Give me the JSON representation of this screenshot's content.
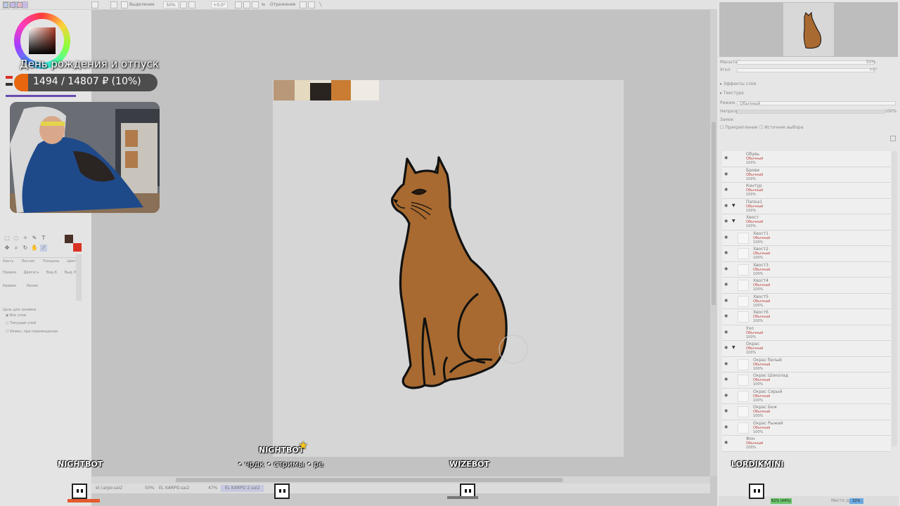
{
  "topbar": {
    "zoom_label": "Выделение",
    "zoom_value": "50%",
    "angle_value": "+0.0°",
    "mirror_label": "Отражение"
  },
  "overlay": {
    "goal_title": "День рождения и отпуск",
    "goal_progress_text": "1494 / 14807 ₽ (10%)",
    "goal_fraction": 0.1,
    "goal_color": "#e8660e"
  },
  "left_panel": {
    "brush_labels": [
      "Кисть",
      "Ластик",
      "Толщина",
      "Цвет"
    ],
    "brush_labels2": [
      "Правка",
      "Двигать",
      "Вид.К",
      "Выд.Л"
    ],
    "brush_labels3": [
      "Кривая",
      "Линия"
    ],
    "fill_section": "Цель для заливки",
    "fill_opt1": "Все слои",
    "fill_opt2": "Текущий слой",
    "fill_opt3": "Измен. при перемещении"
  },
  "right_panel": {
    "zoom_label": "Масштаб",
    "zoom_value": "50%",
    "angle_label": "Угол",
    "angle_value": "+0°",
    "effects_label": "Эффекты слоя",
    "texture_label": "Текстура",
    "mode_label": "Режим",
    "mode_value": "Обычный",
    "opacity_label": "Непрозр.",
    "opacity_value": "100%",
    "lock_label": "Замок",
    "clip_label": "Прикрепление",
    "source_label": "Источник выбора",
    "layers": [
      {
        "name": "Обувь",
        "mode": "Обычный",
        "pct": "100%",
        "indent": 0,
        "folder": false
      },
      {
        "name": "Брови",
        "mode": "Обычный",
        "pct": "100%",
        "indent": 0,
        "folder": false
      },
      {
        "name": "Контур",
        "mode": "Обычный",
        "pct": "100%",
        "indent": 0,
        "folder": false
      },
      {
        "name": "Папка1",
        "mode": "Обычный",
        "pct": "100%",
        "indent": 0,
        "folder": true
      },
      {
        "name": "Хвост",
        "mode": "Обычный",
        "pct": "100%",
        "indent": 0,
        "folder": true
      },
      {
        "name": "Хвост1",
        "mode": "Обычный",
        "pct": "100%",
        "indent": 1,
        "folder": false
      },
      {
        "name": "Хвост2",
        "mode": "Обычный",
        "pct": "100%",
        "indent": 1,
        "folder": false
      },
      {
        "name": "Хвост3",
        "mode": "Обычный",
        "pct": "100%",
        "indent": 1,
        "folder": false
      },
      {
        "name": "Хвост4",
        "mode": "Обычный",
        "pct": "100%",
        "indent": 1,
        "folder": false
      },
      {
        "name": "Хвост5",
        "mode": "Обычный",
        "pct": "100%",
        "indent": 1,
        "folder": false
      },
      {
        "name": "Хвост6",
        "mode": "Обычный",
        "pct": "100%",
        "indent": 1,
        "folder": false
      },
      {
        "name": "Ухо",
        "mode": "Обычный",
        "pct": "100%",
        "indent": 0,
        "folder": false
      },
      {
        "name": "Окрас",
        "mode": "Обычный",
        "pct": "100%",
        "indent": 0,
        "folder": true
      },
      {
        "name": "Окрас белый",
        "mode": "Обычный",
        "pct": "100%",
        "indent": 1,
        "folder": false
      },
      {
        "name": "Окрас Шоколад",
        "mode": "Обычный",
        "pct": "100%",
        "indent": 1,
        "folder": false
      },
      {
        "name": "Окрас Серый",
        "mode": "Обычный",
        "pct": "100%",
        "indent": 1,
        "folder": false
      },
      {
        "name": "Окрас Беж",
        "mode": "Обычный",
        "pct": "100%",
        "indent": 1,
        "folder": false
      },
      {
        "name": "Окрас Рыжий",
        "mode": "Обычный",
        "pct": "100%",
        "indent": 1,
        "folder": false
      },
      {
        "name": "Фон",
        "mode": "Обычный",
        "pct": "100%",
        "indent": 0,
        "folder": false
      }
    ]
  },
  "bots": {
    "bot1": "NIGHTBOT",
    "bot2": "NIGHTBOT",
    "bot2_msg": "• чрдк • стримы • ре",
    "bot3": "WIZEBOT",
    "bot4": "LORDIKMINI"
  },
  "filebar": {
    "file1": "el carpo.sai2",
    "file1_pct": "50%",
    "file2": "EL KARPO.sai2",
    "file2_pct": "47%",
    "file3": "EL KARPO 2.sai2",
    "disk_label": "Место диска",
    "disk_value": "22%",
    "mem_value": "62% (44%)"
  },
  "colors": {
    "cat_fill": "#a86a30",
    "cat_outline": "#111111",
    "primary_swatch": "#4a3128",
    "secondary_swatch": "#d93025"
  }
}
